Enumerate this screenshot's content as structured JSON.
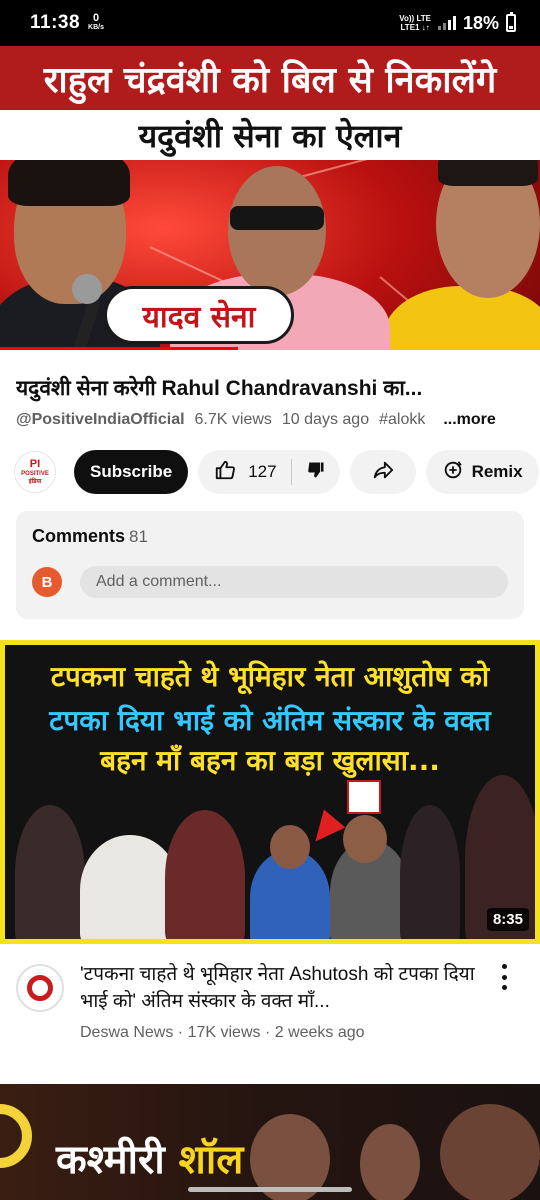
{
  "status_bar": {
    "time": "11:38",
    "data_speed_value": "0",
    "data_speed_unit": "KB/s",
    "network_top": "Vo)) LTE",
    "network_bottom": "LTE1 ↓↑",
    "battery": "18%"
  },
  "player": {
    "banner_line1": "राहुल चंद्रवंशी को बिल से निकालेंगे",
    "banner_line2": "यदुवंशी सेना का ऐलान",
    "speech_bubble": "यादव सेना",
    "progress_fraction": 0.44
  },
  "video": {
    "title": "यदुवंशी सेना करेगी Rahul Chandravanshi का...",
    "channel": "@PositiveIndiaOfficial",
    "views": "6.7K views",
    "age": "10 days ago",
    "hashtag": "#alokk",
    "more_label": "...more",
    "channel_logo_line1": "PI",
    "channel_logo_line2": "POSITIVE इंडिया"
  },
  "actions": {
    "subscribe_label": "Subscribe",
    "like_count": "127",
    "remix_label": "Remix"
  },
  "comments": {
    "heading": "Comments",
    "count": "81",
    "user_initial": "B",
    "placeholder": "Add a comment..."
  },
  "recommended": {
    "thumb_line1": "टपकना चाहते थे भूमिहार नेता आशुतोष को",
    "thumb_line2": "टपका दिया भाई को अंतिम संस्कार के वक्त",
    "thumb_line3": "बहन माँ बहन का बड़ा खुलासा...",
    "duration": "8:35",
    "title": "'टपकना चाहते थे भूमिहार नेता Ashutosh को टपका दिया भाई को' अंतिम संस्कार के वक्त माँ...",
    "meta": "Deswa News · 17K views · 2 weeks ago"
  },
  "next": {
    "thumb_word1": "कश्मीरी",
    "thumb_word2": "शॉल"
  },
  "colors": {
    "brand_red": "#ff0000",
    "banner_red": "#b01b1b",
    "thumb_border": "#f5e21c",
    "avatar_orange": "#e65a2e"
  }
}
